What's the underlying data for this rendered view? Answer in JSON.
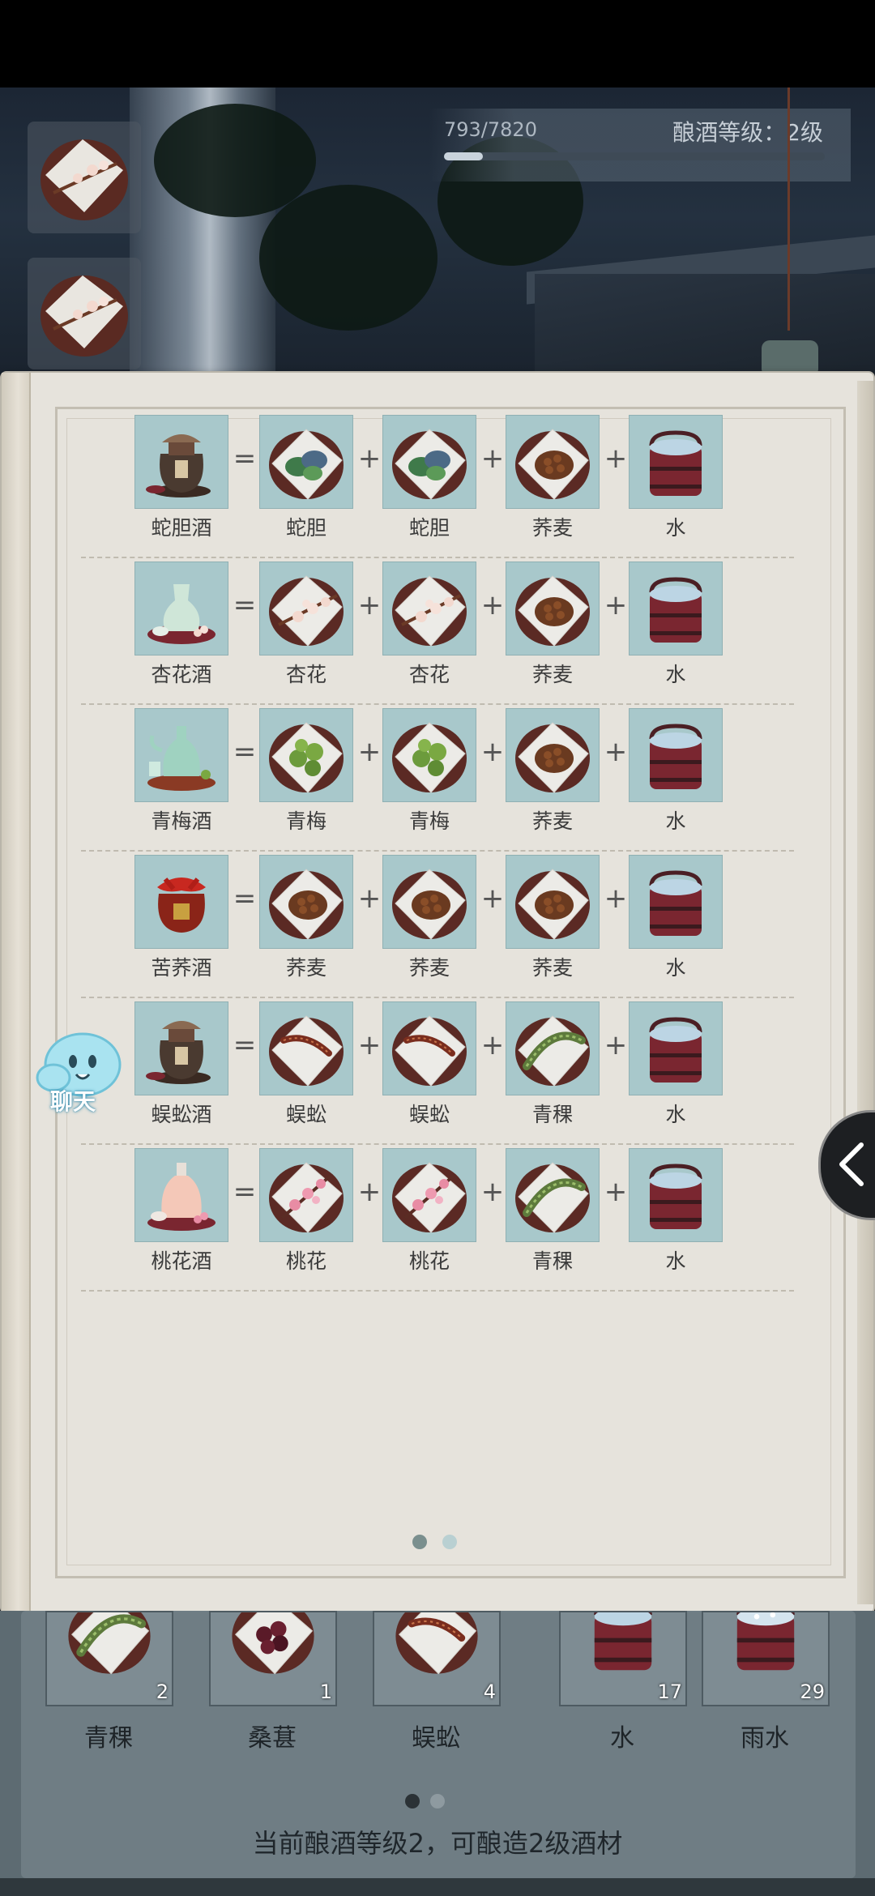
{
  "progress": {
    "text": "793/7820",
    "fraction": 0.1014
  },
  "level_label": "酿酒等级：2级",
  "recipes": [
    {
      "wine": "蛇胆酒",
      "icon": "snake-wine-jar",
      "ingredients": [
        "蛇胆",
        "蛇胆",
        "荞麦",
        "水"
      ]
    },
    {
      "wine": "杏花酒",
      "icon": "apricot-wine-vase",
      "ingredients": [
        "杏花",
        "杏花",
        "荞麦",
        "水"
      ]
    },
    {
      "wine": "青梅酒",
      "icon": "plum-wine-kettle",
      "ingredients": [
        "青梅",
        "青梅",
        "荞麦",
        "水"
      ]
    },
    {
      "wine": "苦荞酒",
      "icon": "buckwheat-wine-jar",
      "ingredients": [
        "荞麦",
        "荞麦",
        "荞麦",
        "水"
      ]
    },
    {
      "wine": "蜈蚣酒",
      "icon": "centipede-wine-jar",
      "ingredients": [
        "蜈蚣",
        "蜈蚣",
        "青稞",
        "水"
      ]
    },
    {
      "wine": "桃花酒",
      "icon": "peach-wine-bottle",
      "ingredients": [
        "桃花",
        "桃花",
        "青稞",
        "水"
      ]
    }
  ],
  "operators": {
    "equals": "=",
    "plus": "+"
  },
  "chat_label": "聊天",
  "inventory": [
    {
      "name": "青稞",
      "count": "2",
      "icon": "barley"
    },
    {
      "name": "桑葚",
      "count": "1",
      "icon": "mulberry"
    },
    {
      "name": "蜈蚣",
      "count": "4",
      "icon": "centipede"
    },
    {
      "name": "水",
      "count": "17",
      "icon": "water"
    },
    {
      "name": "雨水",
      "count": "29",
      "icon": "rainwater"
    }
  ],
  "hint": "当前酿酒等级2，可酿造2级酒材",
  "colors": {
    "slot_bg": "#a8c8cb",
    "page_bg": "#e6e3dc",
    "inventory_bg": "#6f7d84"
  },
  "book_pager": {
    "pages": 2,
    "current": 1
  },
  "inventory_pager": {
    "pages": 2,
    "current": 1
  }
}
